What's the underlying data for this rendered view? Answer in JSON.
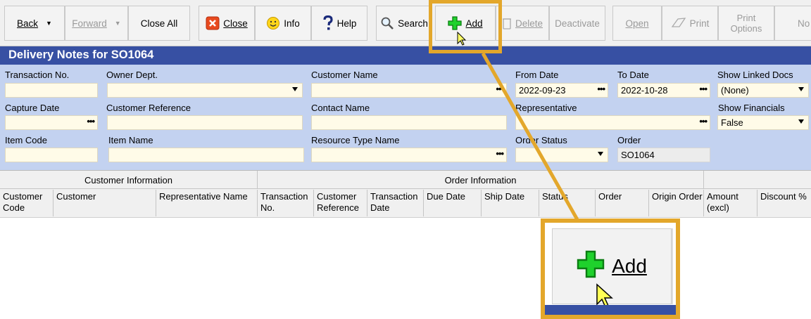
{
  "toolbar": {
    "back": "Back",
    "forward": "Forward",
    "close_all": "Close All",
    "close": "Close",
    "info": "Info",
    "help": "Help",
    "search": "Search",
    "add": "Add",
    "delete": "Delete",
    "deactivate": "Deactivate",
    "open": "Open",
    "print": "Print",
    "print_options_line1": "Print",
    "print_options_line2": "Options",
    "next_partial": "No"
  },
  "title": "Delivery Notes for SO1064",
  "filters": {
    "transaction_no": {
      "label": "Transaction No.",
      "value": ""
    },
    "owner_dept": {
      "label": "Owner Dept.",
      "value": ""
    },
    "customer_name": {
      "label": "Customer Name",
      "value": ""
    },
    "from_date": {
      "label": "From Date",
      "value": "2022-09-23"
    },
    "to_date": {
      "label": "To Date",
      "value": "2022-10-28"
    },
    "show_linked_docs": {
      "label": "Show Linked Docs",
      "value": "(None)"
    },
    "capture_date": {
      "label": "Capture Date",
      "value": ""
    },
    "customer_reference": {
      "label": "Customer Reference",
      "value": ""
    },
    "contact_name": {
      "label": "Contact Name",
      "value": ""
    },
    "representative": {
      "label": "Representative",
      "value": ""
    },
    "show_financials": {
      "label": "Show Financials",
      "value": "False"
    },
    "item_code": {
      "label": "Item Code",
      "value": ""
    },
    "item_name": {
      "label": "Item Name",
      "value": ""
    },
    "resource_type_name": {
      "label": "Resource Type Name",
      "value": ""
    },
    "order_status": {
      "label": "Order Status",
      "value": ""
    },
    "order": {
      "label": "Order",
      "value": "SO1064"
    }
  },
  "grid": {
    "groups": [
      "Customer Information",
      "Order Information"
    ],
    "columns": [
      "Customer\nCode",
      "Customer",
      "Representative Name",
      "Transaction\nNo.",
      "Customer\nReference",
      "Transaction\nDate",
      "Due Date",
      "Ship Date",
      "Status",
      "Order",
      "Origin Order",
      "Amount\n(excl)",
      "Discount %"
    ]
  },
  "callout": {
    "label": "Add"
  },
  "colors": {
    "accent": "#e3a72b",
    "title_bar": "#3750a3",
    "filter_bg": "#c3d2f0",
    "field_bg": "#fffbe8"
  },
  "icons": [
    "close-x-icon",
    "info-smiley-icon",
    "help-question-icon",
    "search-magnifier-icon",
    "add-plus-icon",
    "delete-trash-icon",
    "print-icon",
    "cursor-arrow-icon",
    "ellipsis-icon",
    "dropdown-arrow-icon"
  ]
}
